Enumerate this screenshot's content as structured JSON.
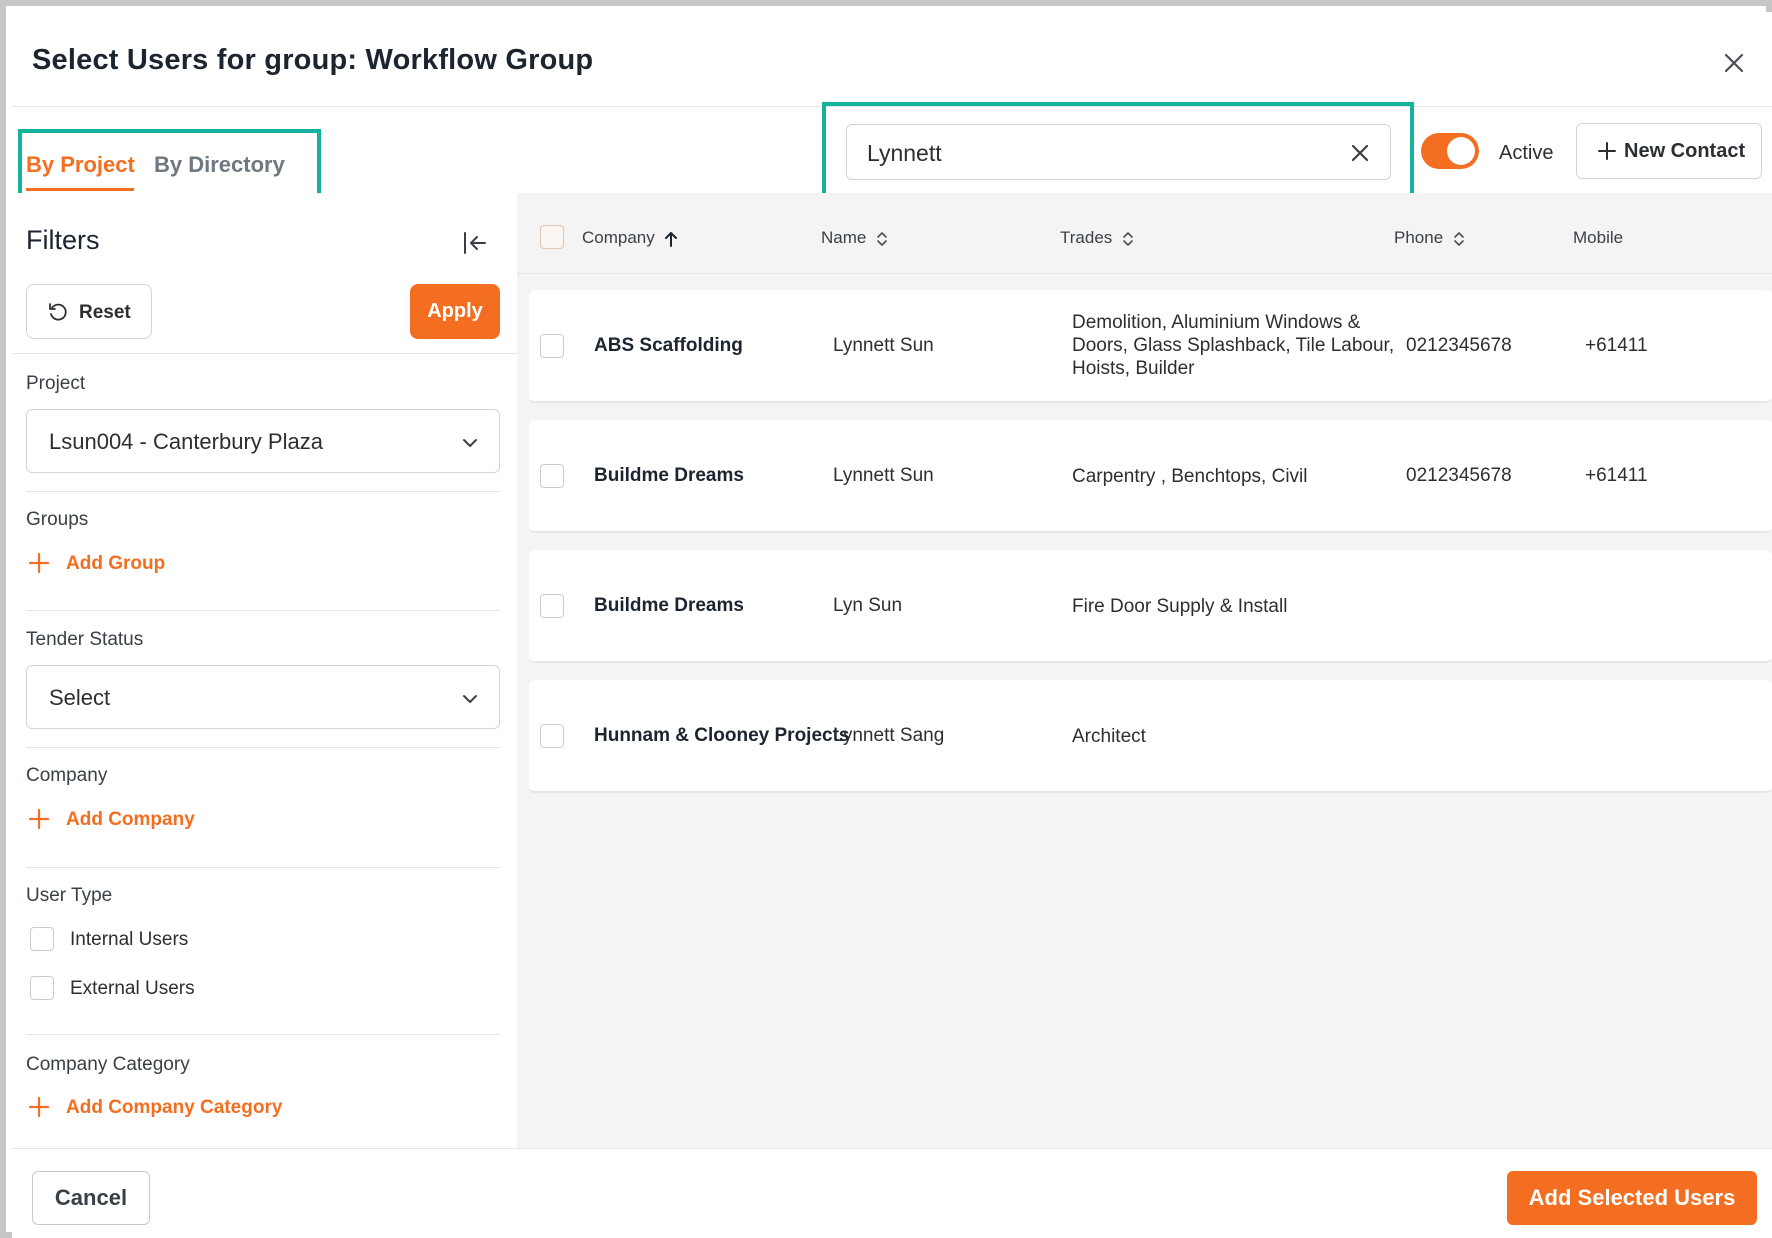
{
  "dialog": {
    "title": "Select Users for group: Workflow Group"
  },
  "tabs": [
    {
      "label": "By Project",
      "active": true
    },
    {
      "label": "By Directory",
      "active": false
    }
  ],
  "search": {
    "value": "Lynnett",
    "placeholder": ""
  },
  "active_toggle": {
    "label": "Active",
    "on": true
  },
  "new_contact": {
    "label": "New Contact"
  },
  "filters": {
    "title": "Filters",
    "reset_label": "Reset",
    "apply_label": "Apply",
    "project": {
      "label": "Project",
      "value": "Lsun004 - Canterbury Plaza"
    },
    "groups": {
      "label": "Groups",
      "add_label": "Add Group"
    },
    "tender_status": {
      "label": "Tender Status",
      "value": "Select"
    },
    "company": {
      "label": "Company",
      "add_label": "Add Company"
    },
    "user_type": {
      "label": "User Type",
      "options": [
        {
          "label": "Internal Users",
          "checked": false
        },
        {
          "label": "External Users",
          "checked": false
        }
      ]
    },
    "company_category": {
      "label": "Company Category",
      "add_label": "Add Company Category"
    }
  },
  "table": {
    "columns": {
      "company": "Company",
      "name": "Name",
      "trades": "Trades",
      "phone": "Phone",
      "mobile": "Mobile"
    },
    "sort": {
      "column": "company",
      "direction": "asc"
    },
    "rows": [
      {
        "company": "ABS Scaffolding",
        "name": "Lynnett Sun",
        "trades": "Demolition, Aluminium Windows & Doors, Glass Splashback, Tile Labour, Hoists, Builder",
        "phone": "0212345678",
        "mobile": "+61411",
        "checked": false
      },
      {
        "company": "Buildme Dreams",
        "name": "Lynnett Sun",
        "trades": "Carpentry , Benchtops, Civil",
        "phone": "0212345678",
        "mobile": "+61411",
        "checked": false
      },
      {
        "company": "Buildme Dreams",
        "name": "Lyn Sun",
        "trades": "Fire Door Supply & Install",
        "phone": "",
        "mobile": "",
        "checked": false
      },
      {
        "company": "Hunnam & Clooney Projects",
        "name": "Lynnett Sang",
        "trades": "Architect",
        "phone": "",
        "mobile": "",
        "checked": false
      }
    ]
  },
  "footer": {
    "cancel_label": "Cancel",
    "add_label": "Add Selected Users"
  },
  "colors": {
    "accent": "#f36e21",
    "highlight": "#14b39c"
  }
}
